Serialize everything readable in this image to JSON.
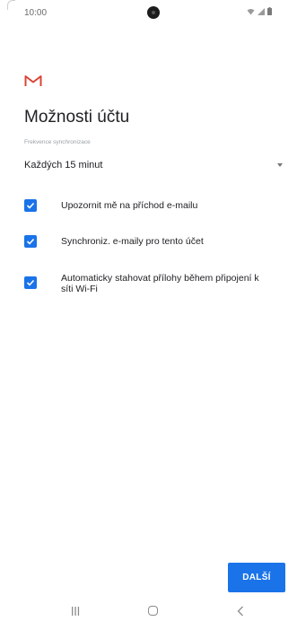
{
  "status_bar": {
    "time": "10:00",
    "icons": [
      "wifi-icon",
      "signal-icon",
      "battery-icon"
    ]
  },
  "app": {
    "logo": "gmail-logo-icon",
    "accent_color": "#1a73e8",
    "logo_color": "#db4437"
  },
  "page": {
    "title": "Možnosti účtu"
  },
  "sync_frequency": {
    "label": "Frekvence synchronizace",
    "value": "Každých 15 minut"
  },
  "options": [
    {
      "label": "Upozornit mě na příchod e-mailu",
      "checked": true
    },
    {
      "label": "Synchroniz. e-maily pro tento účet",
      "checked": true
    },
    {
      "label": "Automaticky stahovat přílohy během připojení k síti Wi-Fi",
      "checked": true
    }
  ],
  "actions": {
    "next_label": "DALŠÍ"
  },
  "nav_bar": {
    "items": [
      "recent-apps-icon",
      "home-icon",
      "back-icon"
    ]
  }
}
